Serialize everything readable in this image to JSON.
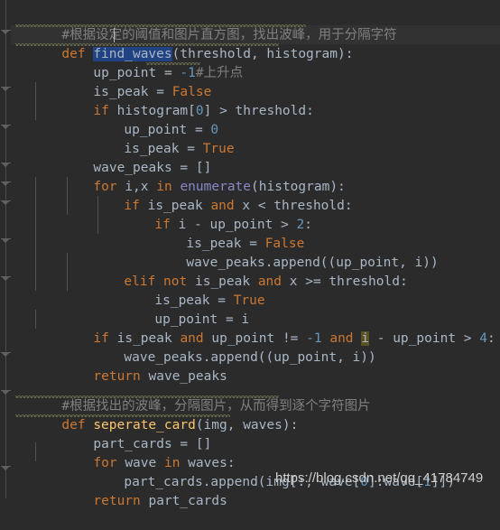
{
  "editor": {
    "theme_name": "darcula",
    "background": "#2b2b2b",
    "caret_line_background": "#323232",
    "selection_color": "#214283",
    "identifier_highlight_color": "#5a5223",
    "default_text_color": "#a9b7c6",
    "keyword_color": "#cc7832",
    "function_name_color": "#ffc66d",
    "builtin_color": "#8888c6",
    "number_color": "#6897bb",
    "comment_color": "#808080"
  },
  "gutter": {
    "fold_markers": [
      {
        "row": 1,
        "state": "expanded"
      },
      {
        "row": 3,
        "state": "expanded"
      },
      {
        "row": 7,
        "state": "expanded"
      },
      {
        "row": 8,
        "state": "expanded"
      },
      {
        "row": 9,
        "state": "expanded"
      },
      {
        "row": 11,
        "state": "expanded"
      },
      {
        "row": 14,
        "state": "expanded"
      },
      {
        "row": 17,
        "state": "expanded"
      },
      {
        "row": 21,
        "state": "expanded"
      },
      {
        "row": 22,
        "state": "expanded"
      },
      {
        "row": 25,
        "state": "expanded"
      }
    ]
  },
  "code": {
    "language": "Python",
    "lines": [
      {
        "n": 1,
        "indent": 0,
        "text": "#根据设定的阈值和图片直方图，找出波峰，用于分隔字符"
      },
      {
        "n": 2,
        "indent": 0,
        "text": "def find_waves(threshold, histogram):"
      },
      {
        "n": 3,
        "indent": 1,
        "text": "up_point = -1#上升点"
      },
      {
        "n": 4,
        "indent": 1,
        "text": "is_peak = False"
      },
      {
        "n": 5,
        "indent": 1,
        "text": "if histogram[0] > threshold:"
      },
      {
        "n": 6,
        "indent": 2,
        "text": "up_point = 0"
      },
      {
        "n": 7,
        "indent": 2,
        "text": "is_peak = True"
      },
      {
        "n": 8,
        "indent": 1,
        "text": "wave_peaks = []"
      },
      {
        "n": 9,
        "indent": 1,
        "text": "for i,x in enumerate(histogram):"
      },
      {
        "n": 10,
        "indent": 2,
        "text": "if is_peak and x < threshold:"
      },
      {
        "n": 11,
        "indent": 3,
        "text": "if i - up_point > 2:"
      },
      {
        "n": 12,
        "indent": 4,
        "text": "is_peak = False"
      },
      {
        "n": 13,
        "indent": 4,
        "text": "wave_peaks.append((up_point, i))"
      },
      {
        "n": 14,
        "indent": 2,
        "text": "elif not is_peak and x >= threshold:"
      },
      {
        "n": 15,
        "indent": 3,
        "text": "is_peak = True"
      },
      {
        "n": 16,
        "indent": 3,
        "text": "up_point = i"
      },
      {
        "n": 17,
        "indent": 1,
        "text": "if is_peak and up_point != -1 and i - up_point > 4:"
      },
      {
        "n": 18,
        "indent": 2,
        "text": "wave_peaks.append((up_point, i))"
      },
      {
        "n": 19,
        "indent": 1,
        "text": "return wave_peaks"
      },
      {
        "n": 20,
        "indent": 0,
        "text": ""
      },
      {
        "n": 21,
        "indent": 0,
        "text": "#根据找出的波峰，分隔图片，从而得到逐个字符图片"
      },
      {
        "n": 22,
        "indent": 0,
        "text": "def seperate_card(img, waves):"
      },
      {
        "n": 23,
        "indent": 1,
        "text": "part_cards = []"
      },
      {
        "n": 24,
        "indent": 1,
        "text": "for wave in waves:"
      },
      {
        "n": 25,
        "indent": 2,
        "text": "part_cards.append(img[:, wave[0]:wave[1]])"
      },
      {
        "n": 26,
        "indent": 1,
        "text": "return part_cards"
      }
    ],
    "selection": {
      "text": "find_waves",
      "line": 2,
      "description": "function name selected on the def line"
    },
    "identifier_highlight": {
      "text": "i",
      "line": 17
    }
  },
  "watermark": {
    "text": "https://blog.csdn.net/qq_41784749"
  }
}
